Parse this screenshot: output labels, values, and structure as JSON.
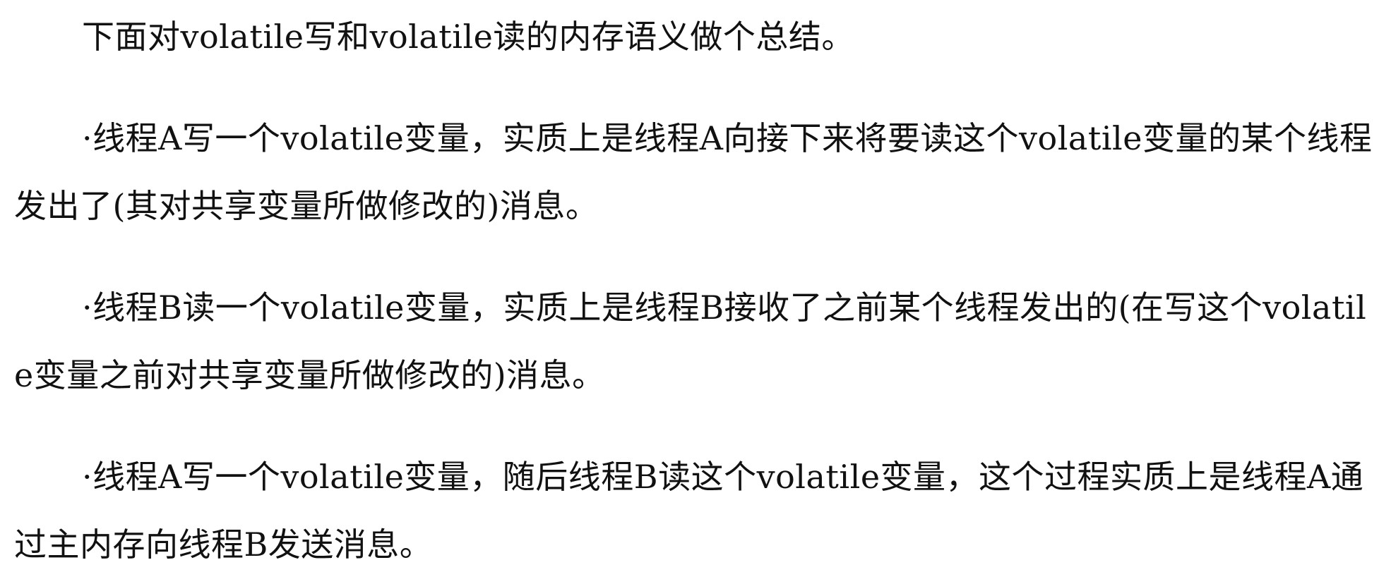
{
  "document": {
    "paragraphs": [
      "下面对volatile写和volatile读的内存语义做个总结。",
      "·线程A写一个volatile变量，实质上是线程A向接下来将要读这个volatile变量的某个线程发出了(其对共享变量所做修改的)消息。",
      "·线程B读一个volatile变量，实质上是线程B接收了之前某个线程发出的(在写这个volatile变量之前对共享变量所做修改的)消息。",
      "·线程A写一个volatile变量，随后线程B读这个volatile变量，这个过程实质上是线程A通过主内存向线程B发送消息。"
    ]
  }
}
